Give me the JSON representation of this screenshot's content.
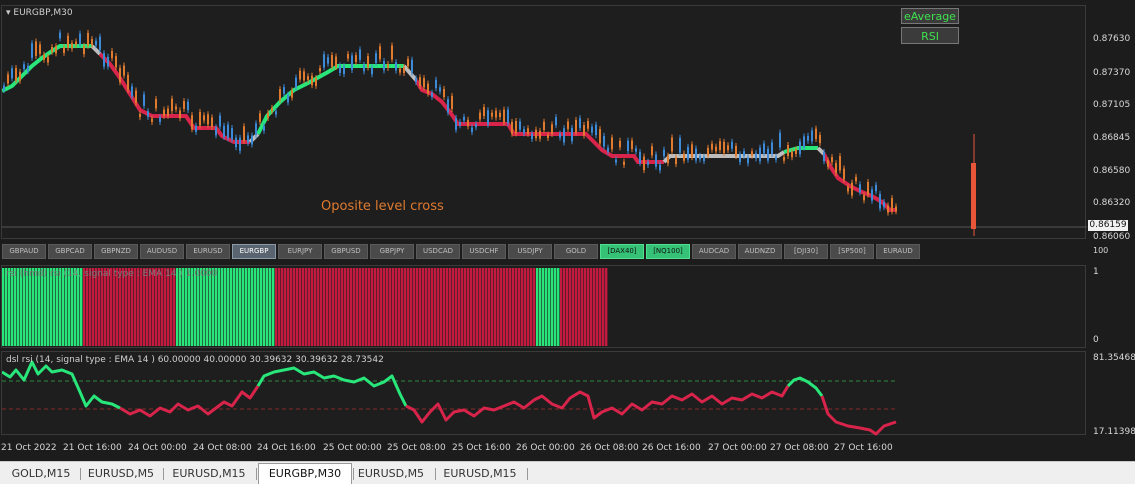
{
  "main_chart": {
    "title": "EURGBP,M30",
    "annotation": "Oposite level cross",
    "current_price": "0.86159",
    "price_labels": [
      "0.87630",
      "0.87370",
      "0.87105",
      "0.86845",
      "0.86580",
      "0.86320",
      "0.86060"
    ],
    "buttons": {
      "moving_average": "eAverage",
      "rsi": "RSI"
    },
    "colors": {
      "up_trend": "#28e67a",
      "down_trend": "#d8244a",
      "flat": "#bdbdbd",
      "candle_up": "#3c8ad8",
      "candle_down": "#e07a2e",
      "indicator_volume": "#e8563a"
    }
  },
  "symbols": [
    "GBPAUD",
    "GBPCAD",
    "GBPNZD",
    "AUDUSD",
    "EURUSD",
    "EURGBP",
    "EURJPY",
    "GBPUSD",
    "GBPJPY",
    "USDCAD",
    "USDCHF",
    "USDJPY",
    "GOLD",
    "[DAX40]",
    "[NQ100]",
    "AUDCAD",
    "AUDNZD",
    "[DJI30]",
    "[SP500]",
    "EURAUD"
  ],
  "active_symbol": "EURGBP",
  "highlighted_symbols": [
    "[DAX40]",
    "[NQ100]"
  ],
  "histogram_pane": {
    "title": "rsi (hmd) rsi (14, signal type : EMA  14 ) 1.0000",
    "scale_labels": {
      "top_small": "100",
      "top": "1",
      "bottom": "0"
    },
    "segments": [
      {
        "state": "up",
        "bars": 27
      },
      {
        "state": "down",
        "bars": 31
      },
      {
        "state": "up",
        "bars": 33
      },
      {
        "state": "down",
        "bars": 87
      },
      {
        "state": "up",
        "bars": 8
      },
      {
        "state": "down",
        "bars": 16
      }
    ]
  },
  "dsl_pane": {
    "title": "dsl rsi (14, signal type : EMA  14 ) 60.00000 40.00000 30.39632 30.39632 28.73542",
    "scale_labels": {
      "top": "81.35468",
      "bottom": "17.11398"
    },
    "levels": {
      "upper": 60,
      "lower": 40
    }
  },
  "time_axis": [
    "21 Oct 2022",
    "21 Oct 16:00",
    "24 Oct 00:00",
    "24 Oct 08:00",
    "24 Oct 16:00",
    "25 Oct 00:00",
    "25 Oct 08:00",
    "25 Oct 16:00",
    "26 Oct 00:00",
    "26 Oct 08:00",
    "26 Oct 16:00",
    "27 Oct 00:00",
    "27 Oct 08:00",
    "27 Oct 16:00"
  ],
  "tabs": [
    "GOLD,M15",
    "EURUSD,M5",
    "EURUSD,M15",
    "EURGBP,M30",
    "EURUSD,M5",
    "EURUSD,M15"
  ],
  "active_tab": "EURGBP,M30"
}
